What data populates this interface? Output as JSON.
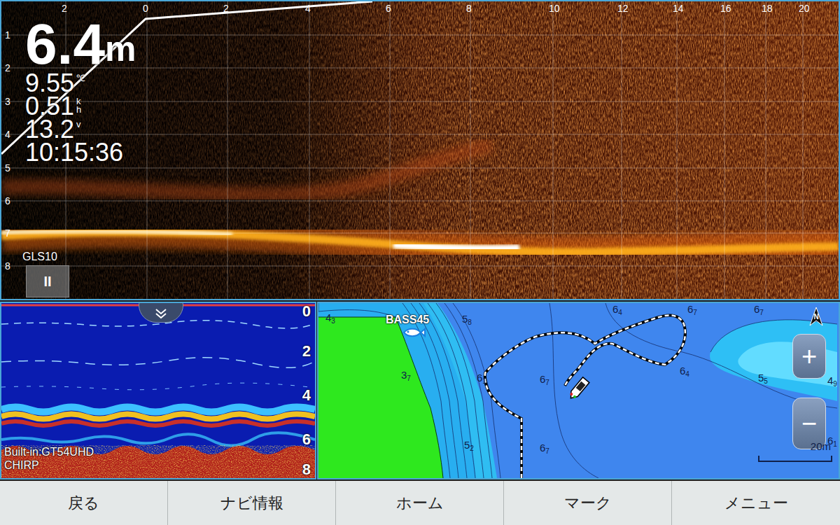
{
  "sonar_live": {
    "depth": "6.4",
    "depth_unit": "m",
    "readings": [
      {
        "value": "9.55",
        "unit": "℃"
      },
      {
        "value": "0.51",
        "unit": "kh"
      },
      {
        "value": "13.2",
        "unit": "v"
      }
    ],
    "time": "10:15:36",
    "range_ticks": [
      "2",
      "0",
      "2",
      "4",
      "6",
      "8",
      "10",
      "12",
      "14",
      "16",
      "18",
      "20"
    ],
    "depth_ticks": [
      "1",
      "2",
      "3",
      "4",
      "5",
      "6",
      "7",
      "8"
    ],
    "source": "GLS10",
    "pause_button": "II",
    "paused": false
  },
  "sonar_2d": {
    "depth_ticks": [
      "0",
      "2",
      "4",
      "6",
      "8"
    ],
    "transducer": "Built-in:GT54UHD",
    "mode": "CHIRP"
  },
  "map": {
    "waypoint": "BASS45",
    "north": "N",
    "zoom_in": "+",
    "zoom_out": "−",
    "scale": "20m",
    "depth_labels": [
      {
        "main": "4",
        "sub": "3"
      },
      {
        "main": "5",
        "sub": "8"
      },
      {
        "main": "3",
        "sub": "7"
      },
      {
        "main": "6",
        "sub": "1"
      },
      {
        "main": "5",
        "sub": "2"
      },
      {
        "main": "6",
        "sub": "7"
      },
      {
        "main": "6",
        "sub": "7"
      },
      {
        "main": "6",
        "sub": "4"
      },
      {
        "main": "6",
        "sub": "7"
      },
      {
        "main": "6",
        "sub": "7"
      },
      {
        "main": "6",
        "sub": "4"
      },
      {
        "main": "5",
        "sub": "5"
      },
      {
        "main": "4",
        "sub": "9"
      },
      {
        "main": "6",
        "sub": "1"
      }
    ]
  },
  "buttons": [
    {
      "label": "戻る"
    },
    {
      "label": "ナビ情報"
    },
    {
      "label": "ホーム"
    },
    {
      "label": "マーク"
    },
    {
      "label": "メニュー"
    }
  ]
}
